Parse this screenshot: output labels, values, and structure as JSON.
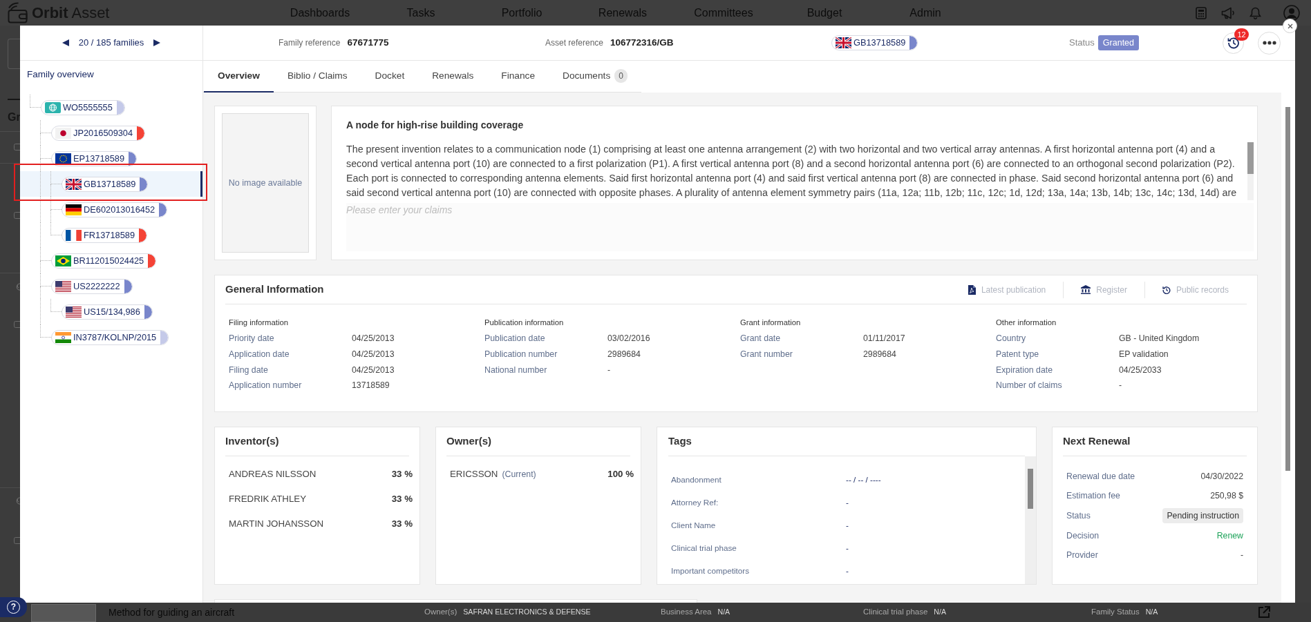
{
  "app_bar": {
    "logo": "**Orbit** Asset",
    "nav": [
      "Dashboards",
      "Tasks",
      "Portfolio",
      "Renewals",
      "Committees",
      "Budget",
      "Admin"
    ]
  },
  "background_panel": {
    "heading": "Gr"
  },
  "family_panel": {
    "pager": "20 / 185 families",
    "title": "Family overview",
    "nodes": [
      {
        "label": "WO5555555",
        "kind": "globe",
        "color": "#c5cae9",
        "selected": false,
        "children": [
          {
            "label": "JP2016509304",
            "kind": "jp",
            "color": "#f44336",
            "selected": false
          },
          {
            "label": "EP13718589",
            "kind": "eu",
            "color": "#7986cb",
            "selected": false,
            "children": [
              {
                "label": "GB13718589",
                "kind": "gb",
                "color": "#7986cb",
                "selected": true
              },
              {
                "label": "DE602013016452",
                "kind": "de",
                "color": "#7986cb",
                "selected": false
              },
              {
                "label": "FR13718589",
                "kind": "fr",
                "color": "#f44336",
                "selected": false
              }
            ]
          },
          {
            "label": "BR112015024425",
            "kind": "br",
            "color": "#f44336",
            "selected": false
          },
          {
            "label": "US2222222",
            "kind": "us",
            "color": "#7986cb",
            "selected": false,
            "children": [
              {
                "label": "US15/134,986",
                "kind": "us",
                "color": "#7986cb",
                "selected": false
              }
            ]
          },
          {
            "label": "IN3787/KOLNP/2015",
            "kind": "in",
            "color": "#c5cae9",
            "selected": false
          }
        ]
      }
    ]
  },
  "asset_header": {
    "fields": [
      {
        "label": "Family reference",
        "value": "67671775"
      },
      {
        "label": "Asset reference",
        "value": "106772316/GB"
      }
    ],
    "chip": {
      "label": "GB13718589",
      "kind": "gb"
    },
    "status": {
      "label": "Status",
      "value": "Granted"
    },
    "history_count": "12"
  },
  "tabs": [
    {
      "label": "Overview",
      "selected": true
    },
    {
      "label": "Biblio / Claims",
      "selected": false
    },
    {
      "label": "Docket",
      "selected": false
    },
    {
      "label": "Renewals",
      "selected": false
    },
    {
      "label": "Finance",
      "selected": false
    },
    {
      "label": "Documents",
      "selected": false,
      "count": "0"
    }
  ],
  "image_card": {
    "text": "No image available"
  },
  "abstract": {
    "title": "A node for high-rise building coverage",
    "text": "The present invention relates to a communication node (1) comprising at least one antenna arrangement (2) with two horizontal and two vertical array antennas. A first horizontal antenna port (4) and a second vertical antenna port (10) are connected to a first polarization (P1). A first vertical antenna port (8) and a second horizontal antenna port (6) are connected to an orthogonal second polarization (P2). Each port is connected to corresponding antenna elements. Said first horizontal antenna port (4) and said first vertical antenna port (8) are connected in phase. Said second horizontal antenna port (6) and said second vertical antenna port (10) are connected with opposite phases. A plurality of antenna element symmetry pairs (11a, 12a; 11b, 12b; 11c, 12c; 1d, 12d; 13a, 14a; 13b, 14b; 13c, 14c; 13d, 14d) are",
    "claims": {
      "placeholder": "Please enter your claims"
    }
  },
  "general_information": {
    "title": "General Information",
    "actions": [
      {
        "kind": "pdf",
        "label": "Latest publication"
      },
      {
        "kind": "register",
        "label": "Register"
      },
      {
        "kind": "records",
        "label": "Public records"
      }
    ],
    "sections": [
      {
        "heading": "Filing information",
        "rows": [
          {
            "label": "Priority date",
            "value": "04/25/2013"
          },
          {
            "label": "Application date",
            "value": "04/25/2013"
          },
          {
            "label": "Filing date",
            "value": "04/25/2013"
          },
          {
            "label": "Application number",
            "value": "13718589"
          }
        ]
      },
      {
        "heading": "Publication information",
        "rows": [
          {
            "label": "Publication date",
            "value": "03/02/2016"
          },
          {
            "label": "Publication number",
            "value": "2989684"
          },
          {
            "label": "National number",
            "value": "-"
          }
        ]
      },
      {
        "heading": "Grant information",
        "rows": [
          {
            "label": "Grant date",
            "value": "01/11/2017"
          },
          {
            "label": "Grant number",
            "value": "2989684"
          }
        ]
      },
      {
        "heading": "Other information",
        "rows": [
          {
            "label": "Country",
            "value": "GB - United Kingdom"
          },
          {
            "label": "Patent type",
            "value": "EP validation"
          },
          {
            "label": "Expiration date",
            "value": "04/25/2033"
          },
          {
            "label": "Number of claims",
            "value": "-"
          }
        ]
      }
    ]
  },
  "inventors": {
    "title": "Inventor(s)",
    "rows": [
      {
        "name": "ANDREAS NILSSON",
        "share": "33 %"
      },
      {
        "name": "FREDRIK ATHLEY",
        "share": "33 %"
      },
      {
        "name": "MARTIN JOHANSSON",
        "share": "33 %"
      }
    ]
  },
  "owners": {
    "title": "Owner(s)",
    "rows": [
      {
        "name": "ERICSSON",
        "note": "(Current)",
        "share": "100 %"
      }
    ]
  },
  "tags": {
    "title": "Tags",
    "rows": [
      {
        "label": "Abandonment",
        "value": "-- / -- / ----"
      },
      {
        "label": "Attorney Ref:",
        "value": "-"
      },
      {
        "label": "Client Name",
        "value": "-"
      },
      {
        "label": "Clinical trial phase",
        "value": "-"
      },
      {
        "label": "Important competitors",
        "value": "-"
      }
    ]
  },
  "next_renewal": {
    "title": "Next Renewal",
    "rows": [
      {
        "label": "Renewal due date",
        "value": "04/30/2022",
        "kind": "text"
      },
      {
        "label": "Estimation fee",
        "value": "250,98 $",
        "kind": "text"
      },
      {
        "label": "Status",
        "value": "Pending instruction",
        "kind": "badge"
      },
      {
        "label": "Decision",
        "value": "Renew",
        "kind": "positive"
      },
      {
        "label": "Provider",
        "value": "-",
        "kind": "text"
      }
    ]
  },
  "background_row": {
    "title": "Method for guiding an aircraft",
    "fields": [
      {
        "label": "Owner(s)",
        "value": "SAFRAN ELECTRONICS & DEFENSE"
      },
      {
        "label": "Business Area",
        "value": "N/A"
      },
      {
        "label": "Clinical trial phase",
        "value": "N/A"
      },
      {
        "label": "Family Status",
        "value": "N/A"
      }
    ]
  },
  "help_button": {
    "label": "?"
  }
}
